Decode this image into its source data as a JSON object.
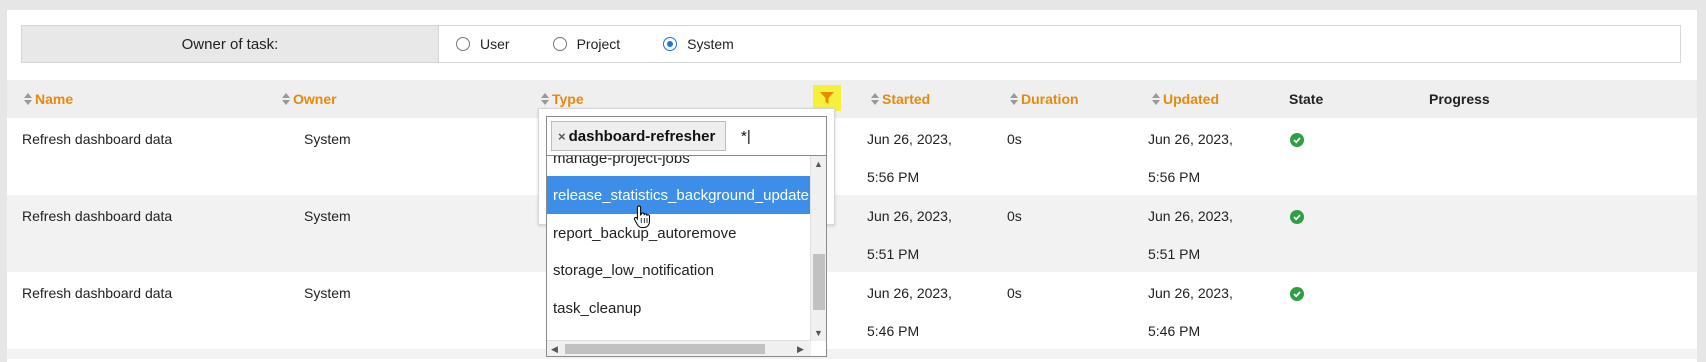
{
  "owner_filter": {
    "label": "Owner of task:",
    "options": [
      {
        "label": "User",
        "checked": false
      },
      {
        "label": "Project",
        "checked": false
      },
      {
        "label": "System",
        "checked": true
      }
    ]
  },
  "table": {
    "columns": [
      {
        "label": "Name",
        "sortable": true
      },
      {
        "label": "Owner",
        "sortable": true
      },
      {
        "label": "Type",
        "sortable": true
      },
      {
        "label": "Started",
        "sortable": true
      },
      {
        "label": "Duration",
        "sortable": true
      },
      {
        "label": "Updated",
        "sortable": true
      },
      {
        "label": "State",
        "sortable": false
      },
      {
        "label": "Progress",
        "sortable": false
      }
    ],
    "rows": [
      {
        "name": "Refresh dashboard data",
        "owner": "System",
        "started_date": "Jun 26, 2023,",
        "started_time": "5:56 PM",
        "duration": "0s",
        "updated_date": "Jun 26, 2023,",
        "updated_time": "5:56 PM",
        "state": "success"
      },
      {
        "name": "Refresh dashboard data",
        "owner": "System",
        "started_date": "Jun 26, 2023,",
        "started_time": "5:51 PM",
        "duration": "0s",
        "updated_date": "Jun 26, 2023,",
        "updated_time": "5:51 PM",
        "state": "success"
      },
      {
        "name": "Refresh dashboard data",
        "owner": "System",
        "started_date": "Jun 26, 2023,",
        "started_time": "5:46 PM",
        "duration": "0s",
        "updated_date": "Jun 26, 2023,",
        "updated_time": "5:46 PM",
        "state": "success"
      }
    ]
  },
  "type_filter": {
    "selected_tag": "dashboard-refresher",
    "remove_glyph": "×",
    "input_value": "*|",
    "options": [
      {
        "label": "manage-project-jobs",
        "highlighted": false
      },
      {
        "label": "release_statistics_background_update",
        "highlighted": true
      },
      {
        "label": "report_backup_autoremove",
        "highlighted": false
      },
      {
        "label": "storage_low_notification",
        "highlighted": false
      },
      {
        "label": "task_cleanup",
        "highlighted": false
      }
    ]
  },
  "colors": {
    "accent_header": "#e8890c",
    "highlight": "#3d8ee8",
    "filter_active": "#f5f03a",
    "success": "#2ea043",
    "radio_checked": "#1a73e8"
  },
  "icons": {
    "sort": "sort-icon",
    "filter": "funnel-icon",
    "state_ok": "check-circle-icon",
    "cursor": "hand-pointer-icon"
  }
}
